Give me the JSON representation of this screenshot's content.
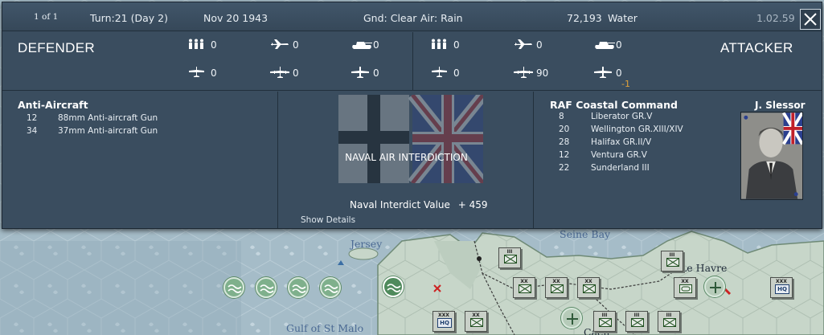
{
  "topbar": {
    "page_indicator": "1 of 1",
    "turn": "Turn:21 (Day 2)",
    "date": "Nov 20 1943",
    "ground": "Gnd: Clear",
    "air": "Air: Rain",
    "hex_id": "72,193",
    "terrain": "Water",
    "version": "1.02.59"
  },
  "defender": {
    "title": "DEFENDER",
    "stats": {
      "infantry": "0",
      "fighters": "0",
      "tanks": "0",
      "recon": "0",
      "bombers": "0",
      "transports": "0"
    }
  },
  "attacker": {
    "title": "ATTACKER",
    "stats": {
      "infantry": "0",
      "fighters": "0",
      "tanks": "0",
      "recon": "0",
      "bombers": "90",
      "transports": "0"
    },
    "transports_loss": "-1"
  },
  "defender_units": {
    "group": "Anti-Aircraft",
    "items": [
      {
        "count": "12",
        "name": "88mm Anti-aircraft Gun"
      },
      {
        "count": "34",
        "name": "37mm Anti-aircraft Gun"
      }
    ]
  },
  "combat": {
    "mission": "NAVAL AIR INTERDICTION",
    "interdict_label": "Naval Interdict Value",
    "interdict_value": "+ 459",
    "show_details": "Show Details"
  },
  "attacker_units": {
    "group": "RAF Coastal Command",
    "commander": "J. Slessor",
    "items": [
      {
        "count": "8",
        "name": "Liberator GR.V"
      },
      {
        "count": "20",
        "name": "Wellington GR.XIII/XIV"
      },
      {
        "count": "28",
        "name": "Halifax GR.II/V"
      },
      {
        "count": "12",
        "name": "Ventura GR.V"
      },
      {
        "count": "22",
        "name": "Sunderland III"
      }
    ]
  },
  "map": {
    "labels": {
      "jersey": "Jersey",
      "seine_bay": "Seine Bay",
      "le_havre": "Le Havre",
      "gulf": "Gulf of St Malo",
      "caen": "Caen"
    },
    "counters": [
      {
        "size": "III",
        "kind": "infantry"
      },
      {
        "size": "III",
        "kind": "infantry"
      },
      {
        "size": "XX",
        "kind": "infantry"
      },
      {
        "size": "XX",
        "kind": "infantry"
      },
      {
        "size": "XX",
        "kind": "infantry"
      },
      {
        "size": "XXX",
        "kind": "hq",
        "label": "HQ"
      },
      {
        "size": "XX",
        "kind": "infantry"
      },
      {
        "size": "III",
        "kind": "infantry"
      },
      {
        "size": "III",
        "kind": "infantry"
      },
      {
        "size": "III",
        "kind": "infantry"
      },
      {
        "size": "XX",
        "kind": "armor"
      },
      {
        "size": "XXX",
        "kind": "hq",
        "label": "HQ"
      }
    ]
  },
  "colors": {
    "panel_bg": "#3a4d5f",
    "loss": "#e0a23a",
    "sea": "#9fb6c2",
    "land": "#c3d2c5"
  }
}
